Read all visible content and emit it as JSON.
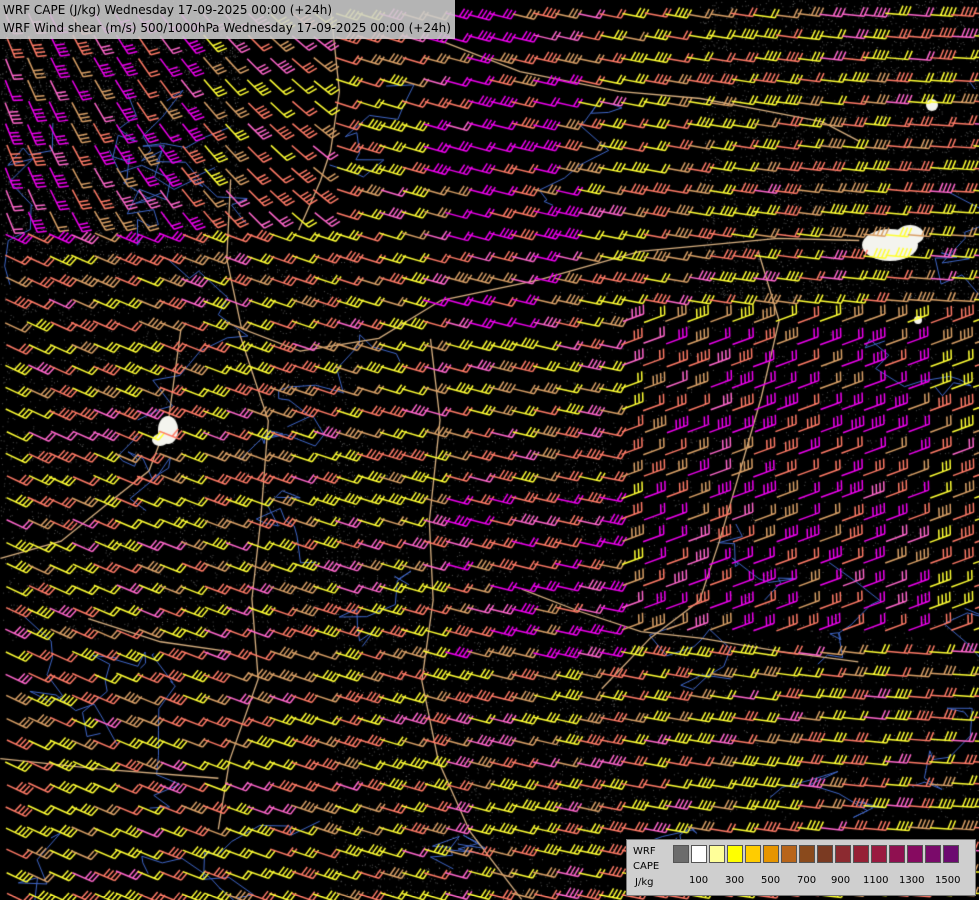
{
  "titles": {
    "line1": "WRF CAPE (J/kg) Wednesday 17-09-2025 00:00 (+24h)",
    "line2": "WRF Wind shear (m/s) 500/1000hPa Wednesday 17-09-2025 00:00 (+24h)"
  },
  "legend": {
    "model": "WRF",
    "variable": "CAPE",
    "unit": "J/kg",
    "ticks": [
      "100",
      "300",
      "500",
      "700",
      "900",
      "1100",
      "1300",
      "1500"
    ],
    "colors": [
      "#6c6c6c",
      "#ffffff",
      "#ffff99",
      "#ffff00",
      "#ffcc00",
      "#e69500",
      "#b8651a",
      "#8a4a1c",
      "#7a3a22",
      "#8c2a30",
      "#962035",
      "#9a1a40",
      "#8f1050",
      "#860a60",
      "#7a0a6a",
      "#6c0a70"
    ]
  },
  "barb_palette": {
    "yellow": "#ffff33",
    "salmon": "#ff7a66",
    "tan": "#d9a066",
    "magenta": "#ee00ee",
    "pink": "#ff66cc"
  },
  "map_colors": {
    "background": "#000000",
    "borders": "#d8b080",
    "rivers": "#3f66c8",
    "cape_patch": "#f4f4ee"
  }
}
